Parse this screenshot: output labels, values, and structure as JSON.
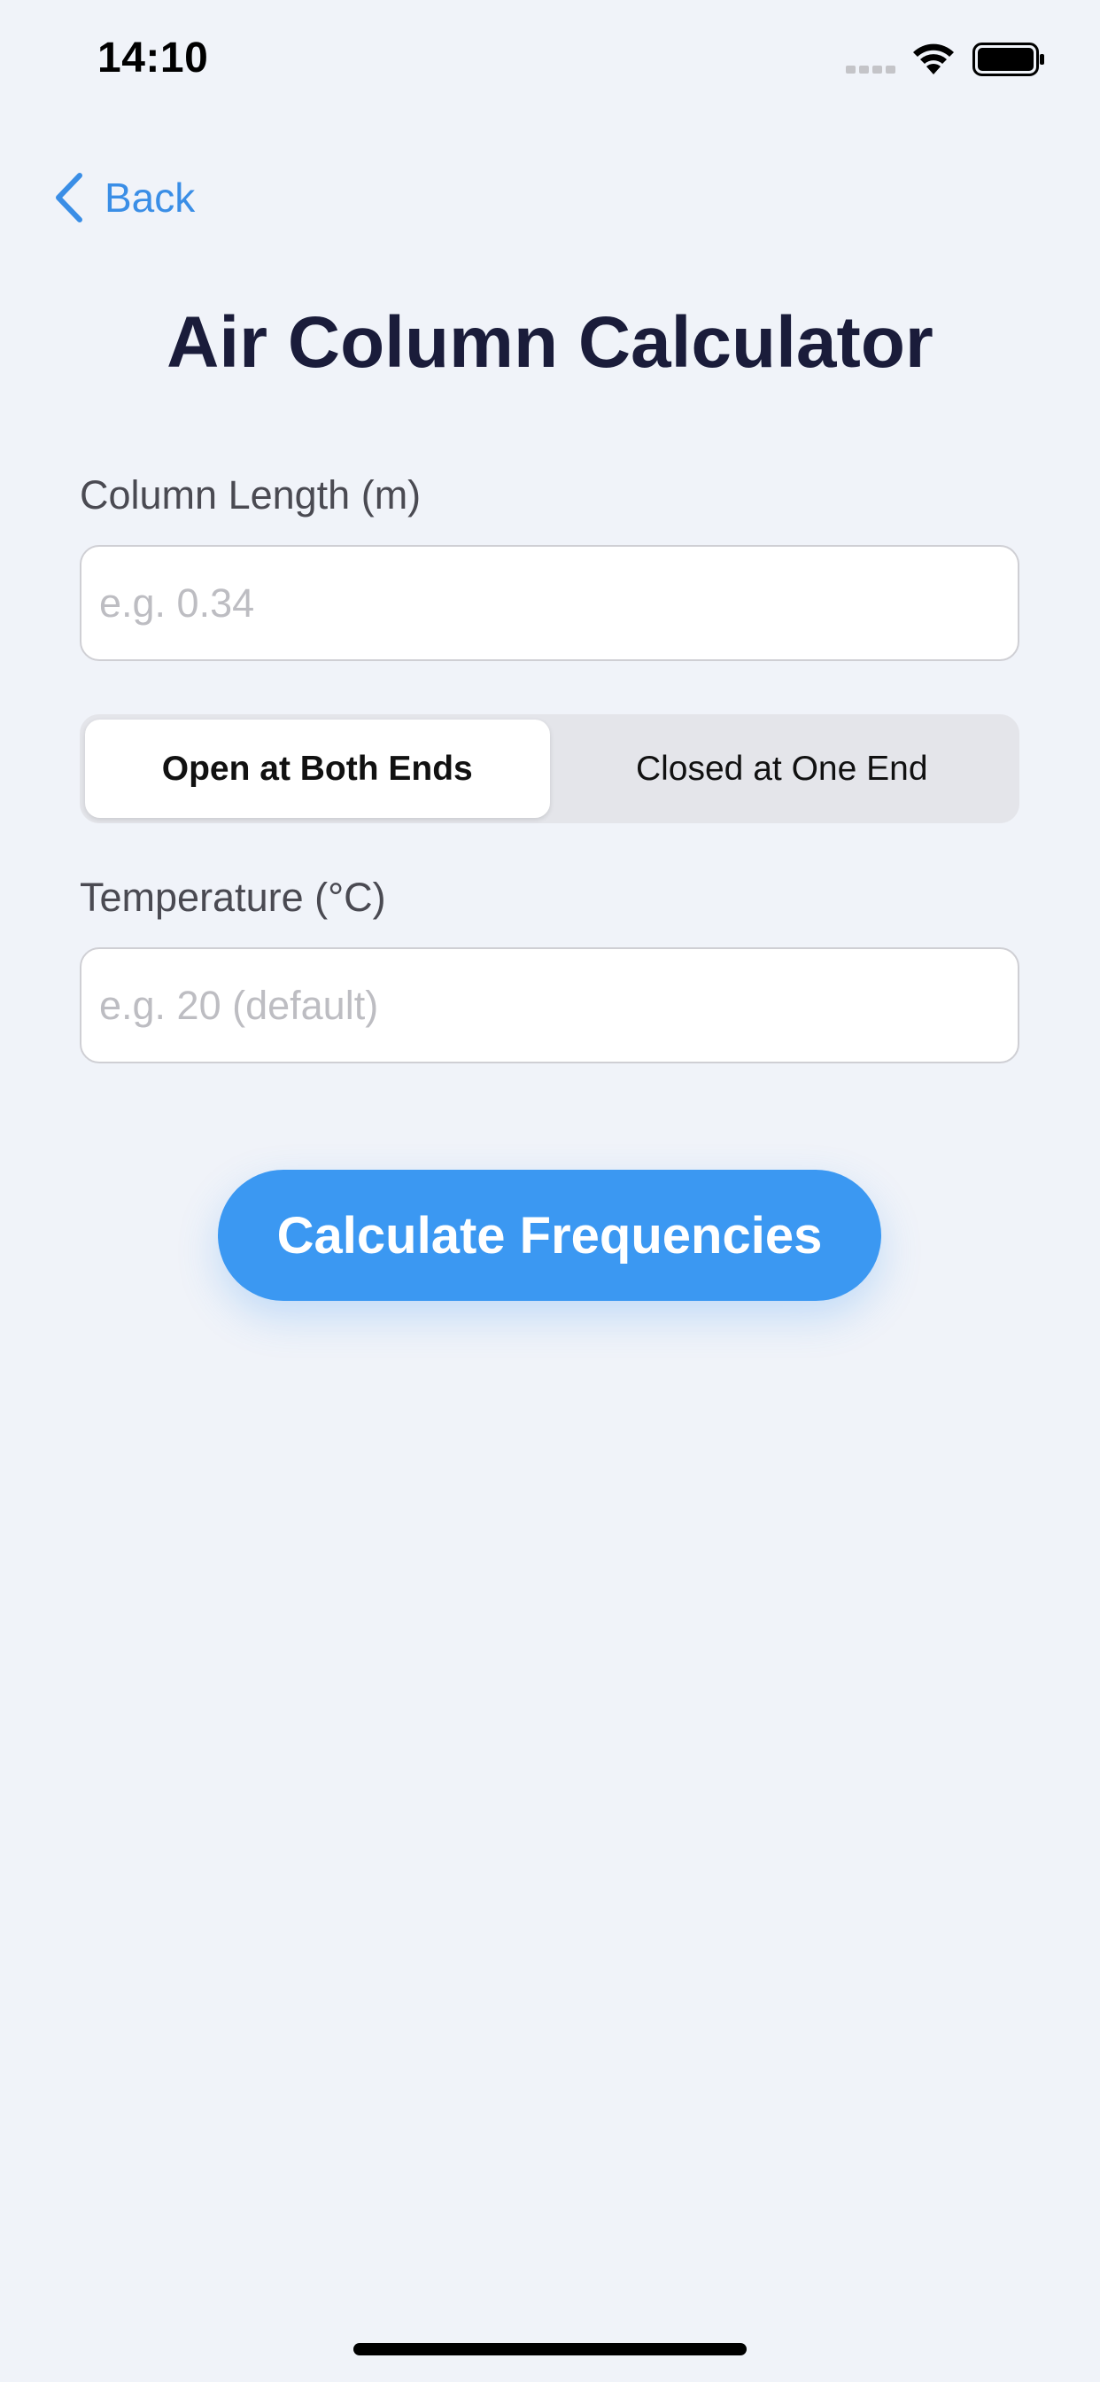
{
  "status_bar": {
    "time": "14:10",
    "signal_icon": "signal-dots-icon",
    "wifi_icon": "wifi-icon",
    "battery_icon": "battery-icon"
  },
  "nav": {
    "back_icon": "chevron-left-icon",
    "back_label": "Back"
  },
  "title": "Air Column Calculator",
  "form": {
    "length": {
      "label": "Column Length (m)",
      "placeholder": "e.g. 0.34",
      "value": ""
    },
    "end_type": {
      "options": [
        "Open at Both Ends",
        "Closed at One End"
      ],
      "selected": "Open at Both Ends"
    },
    "temperature": {
      "label": "Temperature (°C)",
      "placeholder": "e.g. 20 (default)",
      "value": ""
    },
    "submit_label": "Calculate Frequencies"
  },
  "colors": {
    "accent": "#3b98f2",
    "link": "#3a8ee6",
    "background": "#f0f3f9",
    "title": "#1a1c3a"
  }
}
